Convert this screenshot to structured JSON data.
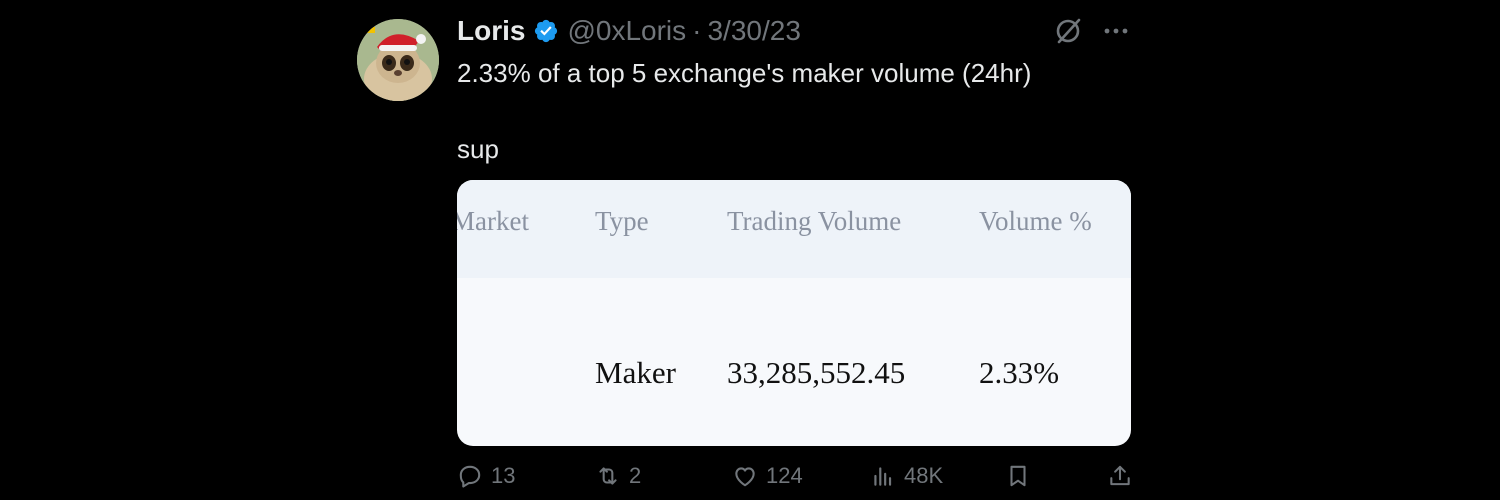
{
  "tweet": {
    "display_name": "Loris",
    "verified": true,
    "handle": "@0xLoris",
    "separator": "·",
    "date": "3/30/23",
    "text_lines": [
      "2.33% of a top 5 exchange's maker volume (24hr)",
      "sup"
    ],
    "icons": {
      "grok": "grok-icon",
      "more": "more-dots-icon",
      "verified": "verified-badge-icon"
    }
  },
  "media": {
    "table": {
      "headers": [
        "Market",
        "Type",
        "Trading Volume",
        "Volume %"
      ],
      "rows": [
        {
          "market": "",
          "type": "Maker",
          "trading_volume": "33,285,552.45",
          "volume_pct": "2.33%"
        }
      ]
    }
  },
  "actions": {
    "replies": {
      "icon": "reply-icon",
      "count": "13"
    },
    "reposts": {
      "icon": "repost-icon",
      "count": "2"
    },
    "likes": {
      "icon": "like-icon",
      "count": "124"
    },
    "views": {
      "icon": "views-icon",
      "count": "48K"
    },
    "bookmark": {
      "icon": "bookmark-icon"
    },
    "share": {
      "icon": "share-icon"
    }
  },
  "colors": {
    "background": "#000000",
    "primary_text": "#e7e9ea",
    "secondary_text": "#71767b",
    "verified": "#1d9bf0",
    "table_header_bg": "#eef3f9",
    "table_body_bg": "#f7f9fc"
  }
}
